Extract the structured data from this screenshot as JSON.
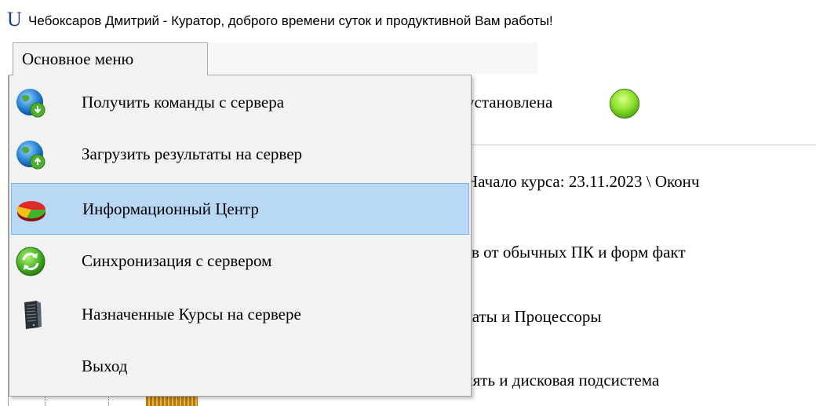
{
  "window": {
    "app_icon": "U",
    "title": "Чебоксаров Дмитрий - Куратор, доброго времени суток и продуктивной Вам работы!"
  },
  "menu": {
    "main_label": "Основное меню",
    "items": [
      {
        "label": "Получить команды с сервера",
        "icon": "globe-download-icon"
      },
      {
        "label": "Загрузить результаты на сервер",
        "icon": "globe-upload-icon"
      },
      {
        "label": "Информационный Центр",
        "icon": "pie-chart-icon",
        "highlighted": true
      },
      {
        "label": "Синхронизация с сервером",
        "icon": "sync-icon"
      },
      {
        "label": "Назначенные Курсы на сервере",
        "icon": "server-icon"
      },
      {
        "label": "Выход",
        "icon": ""
      }
    ]
  },
  "background": {
    "status_text": "установлена",
    "status_color": "#8ee12a",
    "course_text": "Начало курса: 23.11.2023 \\ Оконч",
    "topics": [
      "ров от обычных ПК и форм факт",
      "платы и Процессоры",
      "амять и дисковая подсистема"
    ]
  },
  "colors": {
    "highlight": "#b8d8f5",
    "highlight_border": "#7eb4ea",
    "menu_bg": "#f2f2f2"
  }
}
